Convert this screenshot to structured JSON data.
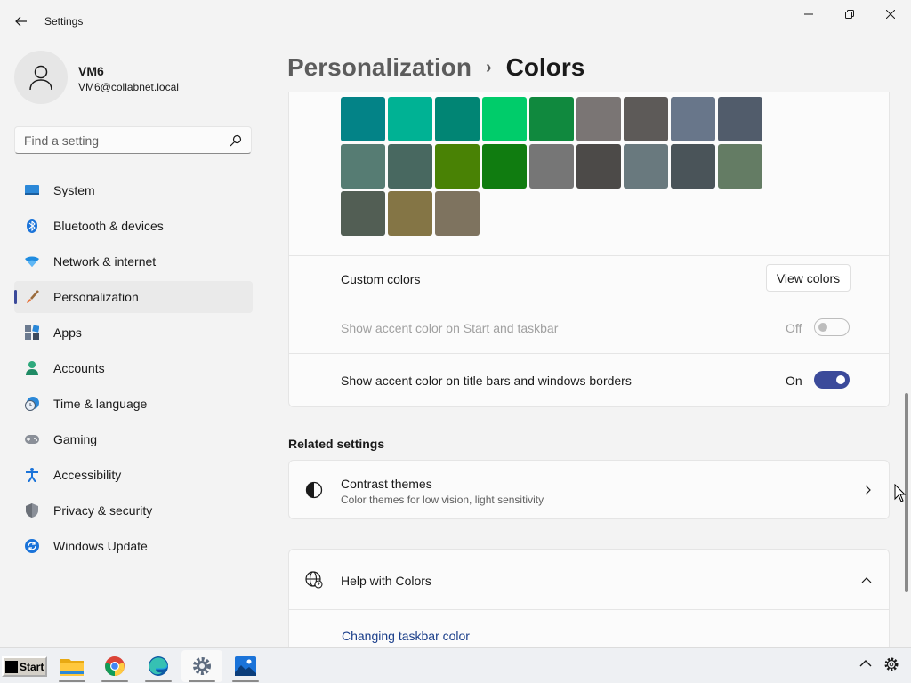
{
  "window": {
    "title": "Settings"
  },
  "user": {
    "name": "VM6",
    "email": "VM6@collabnet.local"
  },
  "search": {
    "placeholder": "Find a setting"
  },
  "nav": {
    "items": [
      {
        "label": "System",
        "icon": "monitor-icon"
      },
      {
        "label": "Bluetooth & devices",
        "icon": "bluetooth-icon"
      },
      {
        "label": "Network & internet",
        "icon": "wifi-icon"
      },
      {
        "label": "Personalization",
        "icon": "brush-icon",
        "active": true
      },
      {
        "label": "Apps",
        "icon": "apps-icon"
      },
      {
        "label": "Accounts",
        "icon": "person-icon"
      },
      {
        "label": "Time & language",
        "icon": "clock-globe-icon"
      },
      {
        "label": "Gaming",
        "icon": "gamepad-icon"
      },
      {
        "label": "Accessibility",
        "icon": "accessibility-icon"
      },
      {
        "label": "Privacy & security",
        "icon": "shield-icon"
      },
      {
        "label": "Windows Update",
        "icon": "update-icon"
      }
    ]
  },
  "breadcrumb": {
    "parent": "Personalization",
    "separator": "›",
    "current": "Colors"
  },
  "accent_swatches": {
    "colors": [
      [
        "#038387",
        "#00b294",
        "#018574",
        "#00cc6a",
        "#10893e",
        "#7a7574",
        "#5d5a58",
        "#68768a",
        "#515c6b"
      ],
      [
        "#567c73",
        "#486860",
        "#498205",
        "#107c10",
        "#767676",
        "#4c4a48",
        "#69797e",
        "#4a5459",
        "#647c64"
      ],
      [
        "#525e54",
        "#847545",
        "#7e735f"
      ]
    ]
  },
  "custom_colors": {
    "label": "Custom colors",
    "button": "View colors"
  },
  "accent_start_taskbar": {
    "label": "Show accent color on Start and taskbar",
    "state_text": "Off",
    "enabled": false,
    "on": false
  },
  "accent_title_bars": {
    "label": "Show accent color on title bars and windows borders",
    "state_text": "On",
    "enabled": true,
    "on": true
  },
  "related": {
    "title": "Related settings",
    "contrast": {
      "title": "Contrast themes",
      "subtitle": "Color themes for low vision, light sensitivity"
    }
  },
  "help": {
    "title": "Help with Colors",
    "link": "Changing taskbar color"
  },
  "taskbar": {
    "start_label": "Start",
    "apps": [
      "file-explorer-icon",
      "chrome-icon",
      "edge-icon",
      "settings-icon",
      "photos-icon"
    ]
  },
  "colors": {
    "accent": "#3b4a9a",
    "background": "#f3f3f3",
    "card": "#fbfbfb"
  }
}
